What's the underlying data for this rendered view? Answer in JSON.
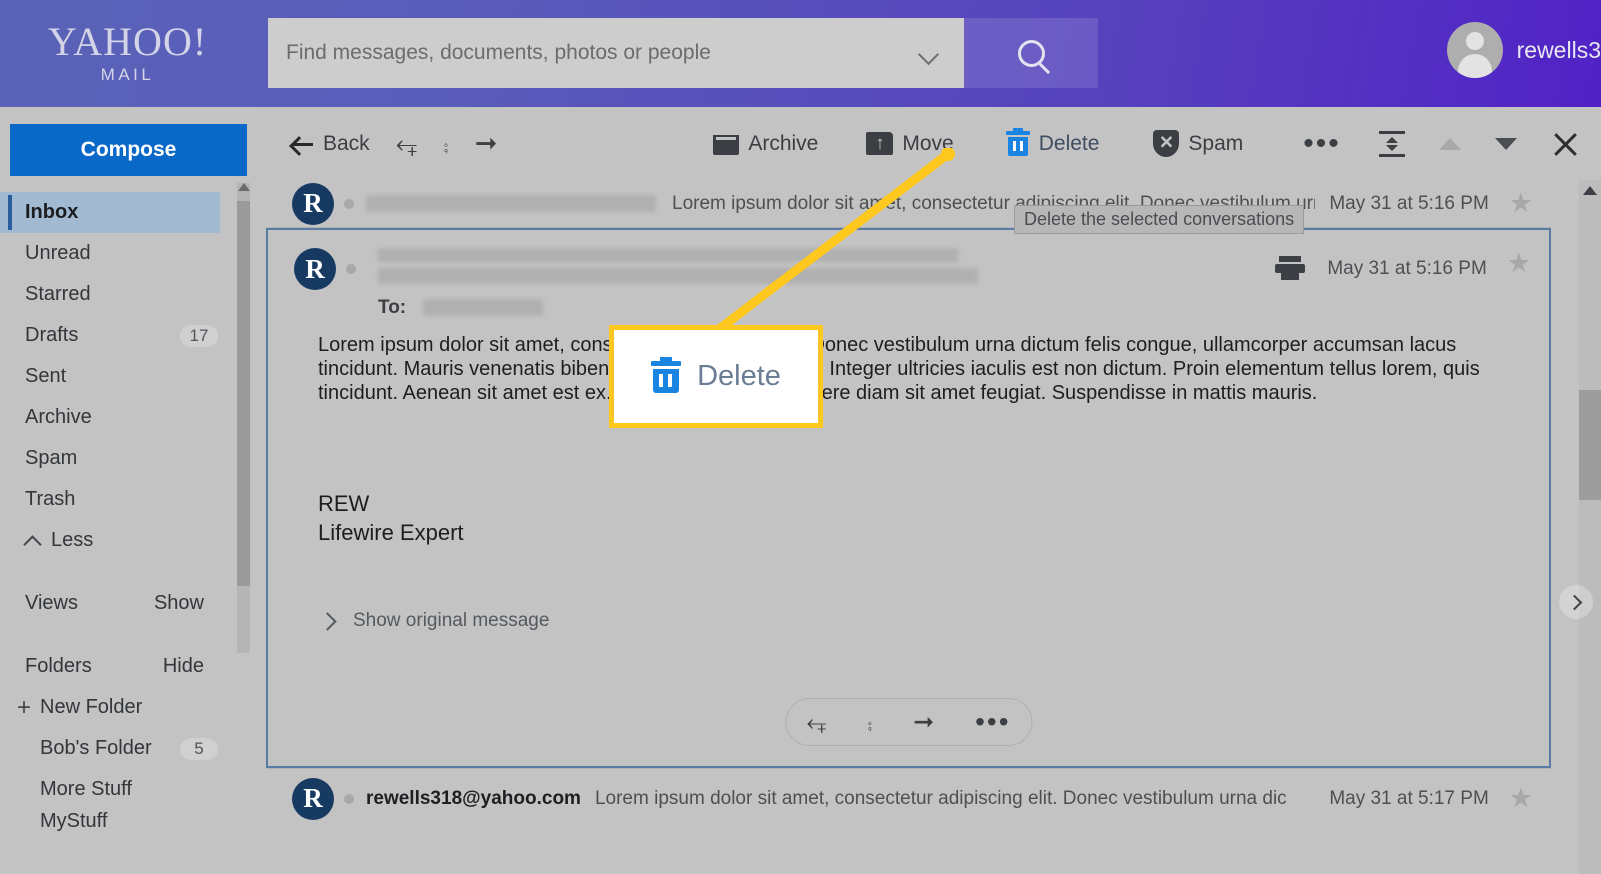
{
  "header": {
    "logo_main": "YAHOO!",
    "logo_sub": "MAIL",
    "search_placeholder": "Find messages, documents, photos or people",
    "search_value": "",
    "search_icon": "search-icon",
    "dropdown_icon": "chevron-down-icon",
    "user_name": "rewells3",
    "avatar_icon": "person-avatar-icon",
    "gradient_from": "#5a63b8",
    "gradient_to": "#5122c6"
  },
  "sidebar": {
    "compose_label": "Compose",
    "compose_color": "#0a69c8",
    "folders": [
      {
        "label": "Inbox",
        "count": "",
        "active": true
      },
      {
        "label": "Unread",
        "count": ""
      },
      {
        "label": "Starred",
        "count": ""
      },
      {
        "label": "Drafts",
        "count": "17"
      },
      {
        "label": "Sent",
        "count": ""
      },
      {
        "label": "Archive",
        "count": ""
      },
      {
        "label": "Spam",
        "count": ""
      },
      {
        "label": "Trash",
        "count": ""
      }
    ],
    "less_label": "Less",
    "views_label": "Views",
    "views_action": "Show",
    "folders_label": "Folders",
    "folders_action": "Hide",
    "new_folder_label": "New Folder",
    "custom_folders": [
      {
        "label": "Bob's Folder",
        "count": "5"
      },
      {
        "label": "More Stuff",
        "count": ""
      },
      {
        "label": "MyStuff",
        "count": ""
      }
    ]
  },
  "toolbar": {
    "back_label": "Back",
    "reply_icon": "reply-icon",
    "reply_all_icon": "reply-all-icon",
    "forward_icon": "forward-icon",
    "archive_label": "Archive",
    "move_label": "Move",
    "delete_label": "Delete",
    "spam_label": "Spam",
    "more_icon": "more-dots-icon",
    "collapse_icon": "collapse-icon",
    "prev_icon": "triangle-up-icon",
    "next_icon": "triangle-down-icon",
    "close_icon": "close-icon",
    "delete_highlight_color": "#1a84e2"
  },
  "tooltip": {
    "text": "Delete the selected conversations"
  },
  "callout": {
    "label": "Delete",
    "icon": "trash-icon",
    "border_color": "#ffc81e",
    "icon_color": "#1a84e2",
    "label_color": "#6a7d95"
  },
  "messages": {
    "top_row": {
      "avatar_letter": "R",
      "sender": "",
      "snippet": "Lorem ipsum dolor sit amet, consectetur adipiscing elit. Donec vestibulum urna dic",
      "date": "May 31 at 5:16 PM",
      "star_icon": "star-icon"
    },
    "open": {
      "avatar_letter": "R",
      "to_label": "To:",
      "date": "May 31 at 5:16 PM",
      "print_icon": "print-icon",
      "star_icon": "star-icon",
      "body_paragraph": "Lorem ipsum dolor sit amet, consectetur adipiscing elit. Donec vestibulum urna dictum felis congue, ullamcorper accumsan lacus tincidunt. Mauris venenatis bibendum ante consectetur a. Integer ultricies iaculis est non dictum. Proin elementum tellus lorem, quis tincidunt. Aenean sit amet est ex. Nullam commodo posuere diam sit amet feugiat. Suspendisse in mattis mauris.",
      "signature_line1": "REW",
      "signature_line2": "Lifewire Expert",
      "show_original_label": "Show original message",
      "actions": {
        "reply_icon": "reply-icon",
        "reply_all_icon": "reply-all-icon",
        "forward_icon": "forward-icon",
        "more_icon": "more-dots-icon"
      }
    },
    "bottom_row": {
      "avatar_letter": "R",
      "sender": "rewells318@yahoo.com",
      "snippet": "Lorem ipsum dolor sit amet, consectetur adipiscing elit. Donec vestibulum urna dic",
      "date": "May 31 at 5:17 PM",
      "star_icon": "star-icon"
    }
  }
}
